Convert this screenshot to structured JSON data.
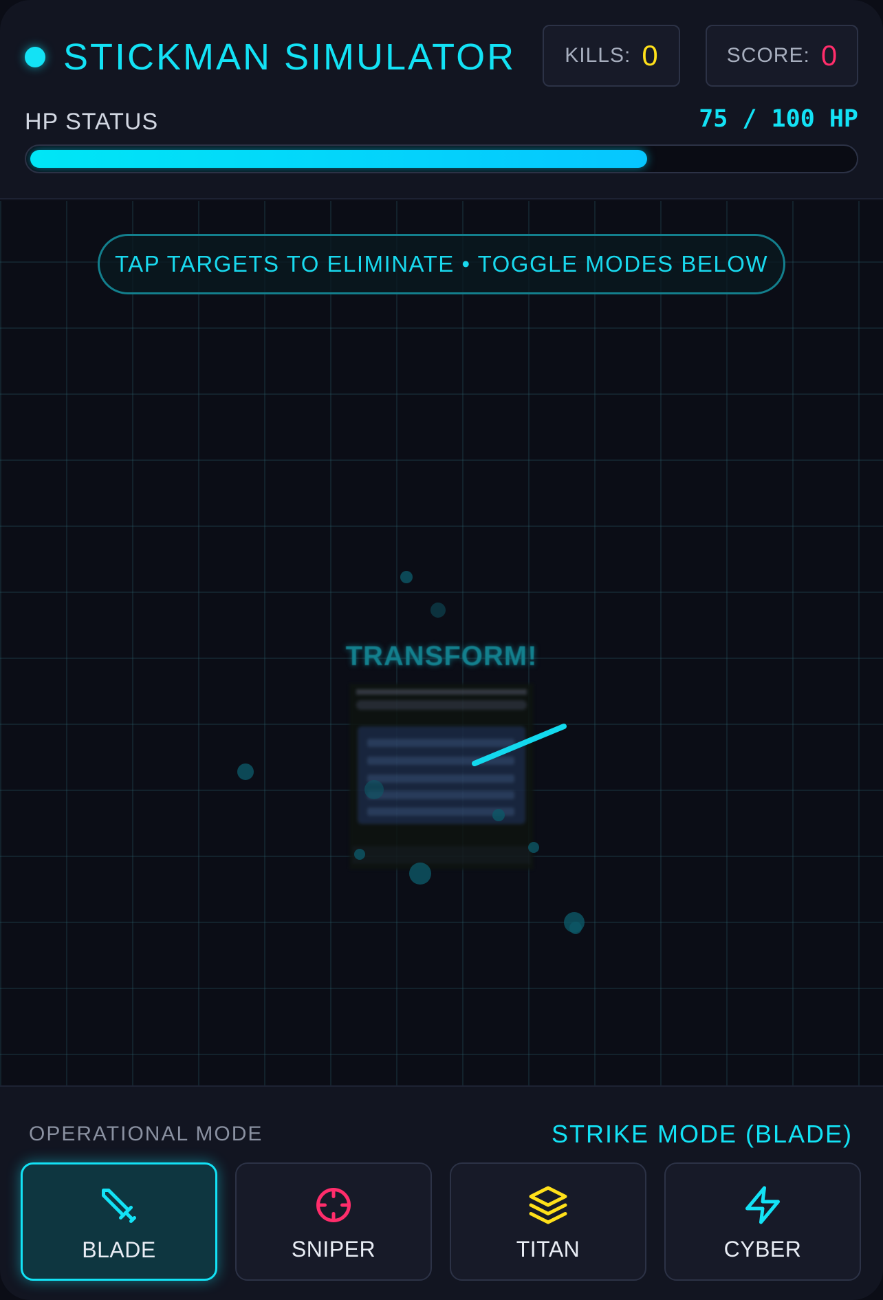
{
  "app": {
    "title": "STICKMAN SIMULATOR",
    "accent_color": "#13e2f5"
  },
  "stats": {
    "kills_label": "KILLS:",
    "kills_value": "0",
    "score_label": "SCORE:",
    "score_value": "0"
  },
  "hp": {
    "label": "HP STATUS",
    "text": "75 / 100 HP",
    "current": 75,
    "max": 100
  },
  "arena": {
    "hint": "TAP TARGETS TO ELIMINATE • TOGGLE MODES BELOW",
    "transform_text": "TRANSFORM!"
  },
  "modes": {
    "section_label": "OPERATIONAL MODE",
    "current_label": "STRIKE MODE (BLADE)",
    "items": [
      {
        "label": "BLADE",
        "icon": "sword-icon",
        "color": "#13e2f5",
        "active": true
      },
      {
        "label": "SNIPER",
        "icon": "crosshair-icon",
        "color": "#ff2d6b",
        "active": false
      },
      {
        "label": "TITAN",
        "icon": "layers-icon",
        "color": "#ffe01a",
        "active": false
      },
      {
        "label": "CYBER",
        "icon": "lightning-icon",
        "color": "#13e2f5",
        "active": false
      }
    ]
  }
}
